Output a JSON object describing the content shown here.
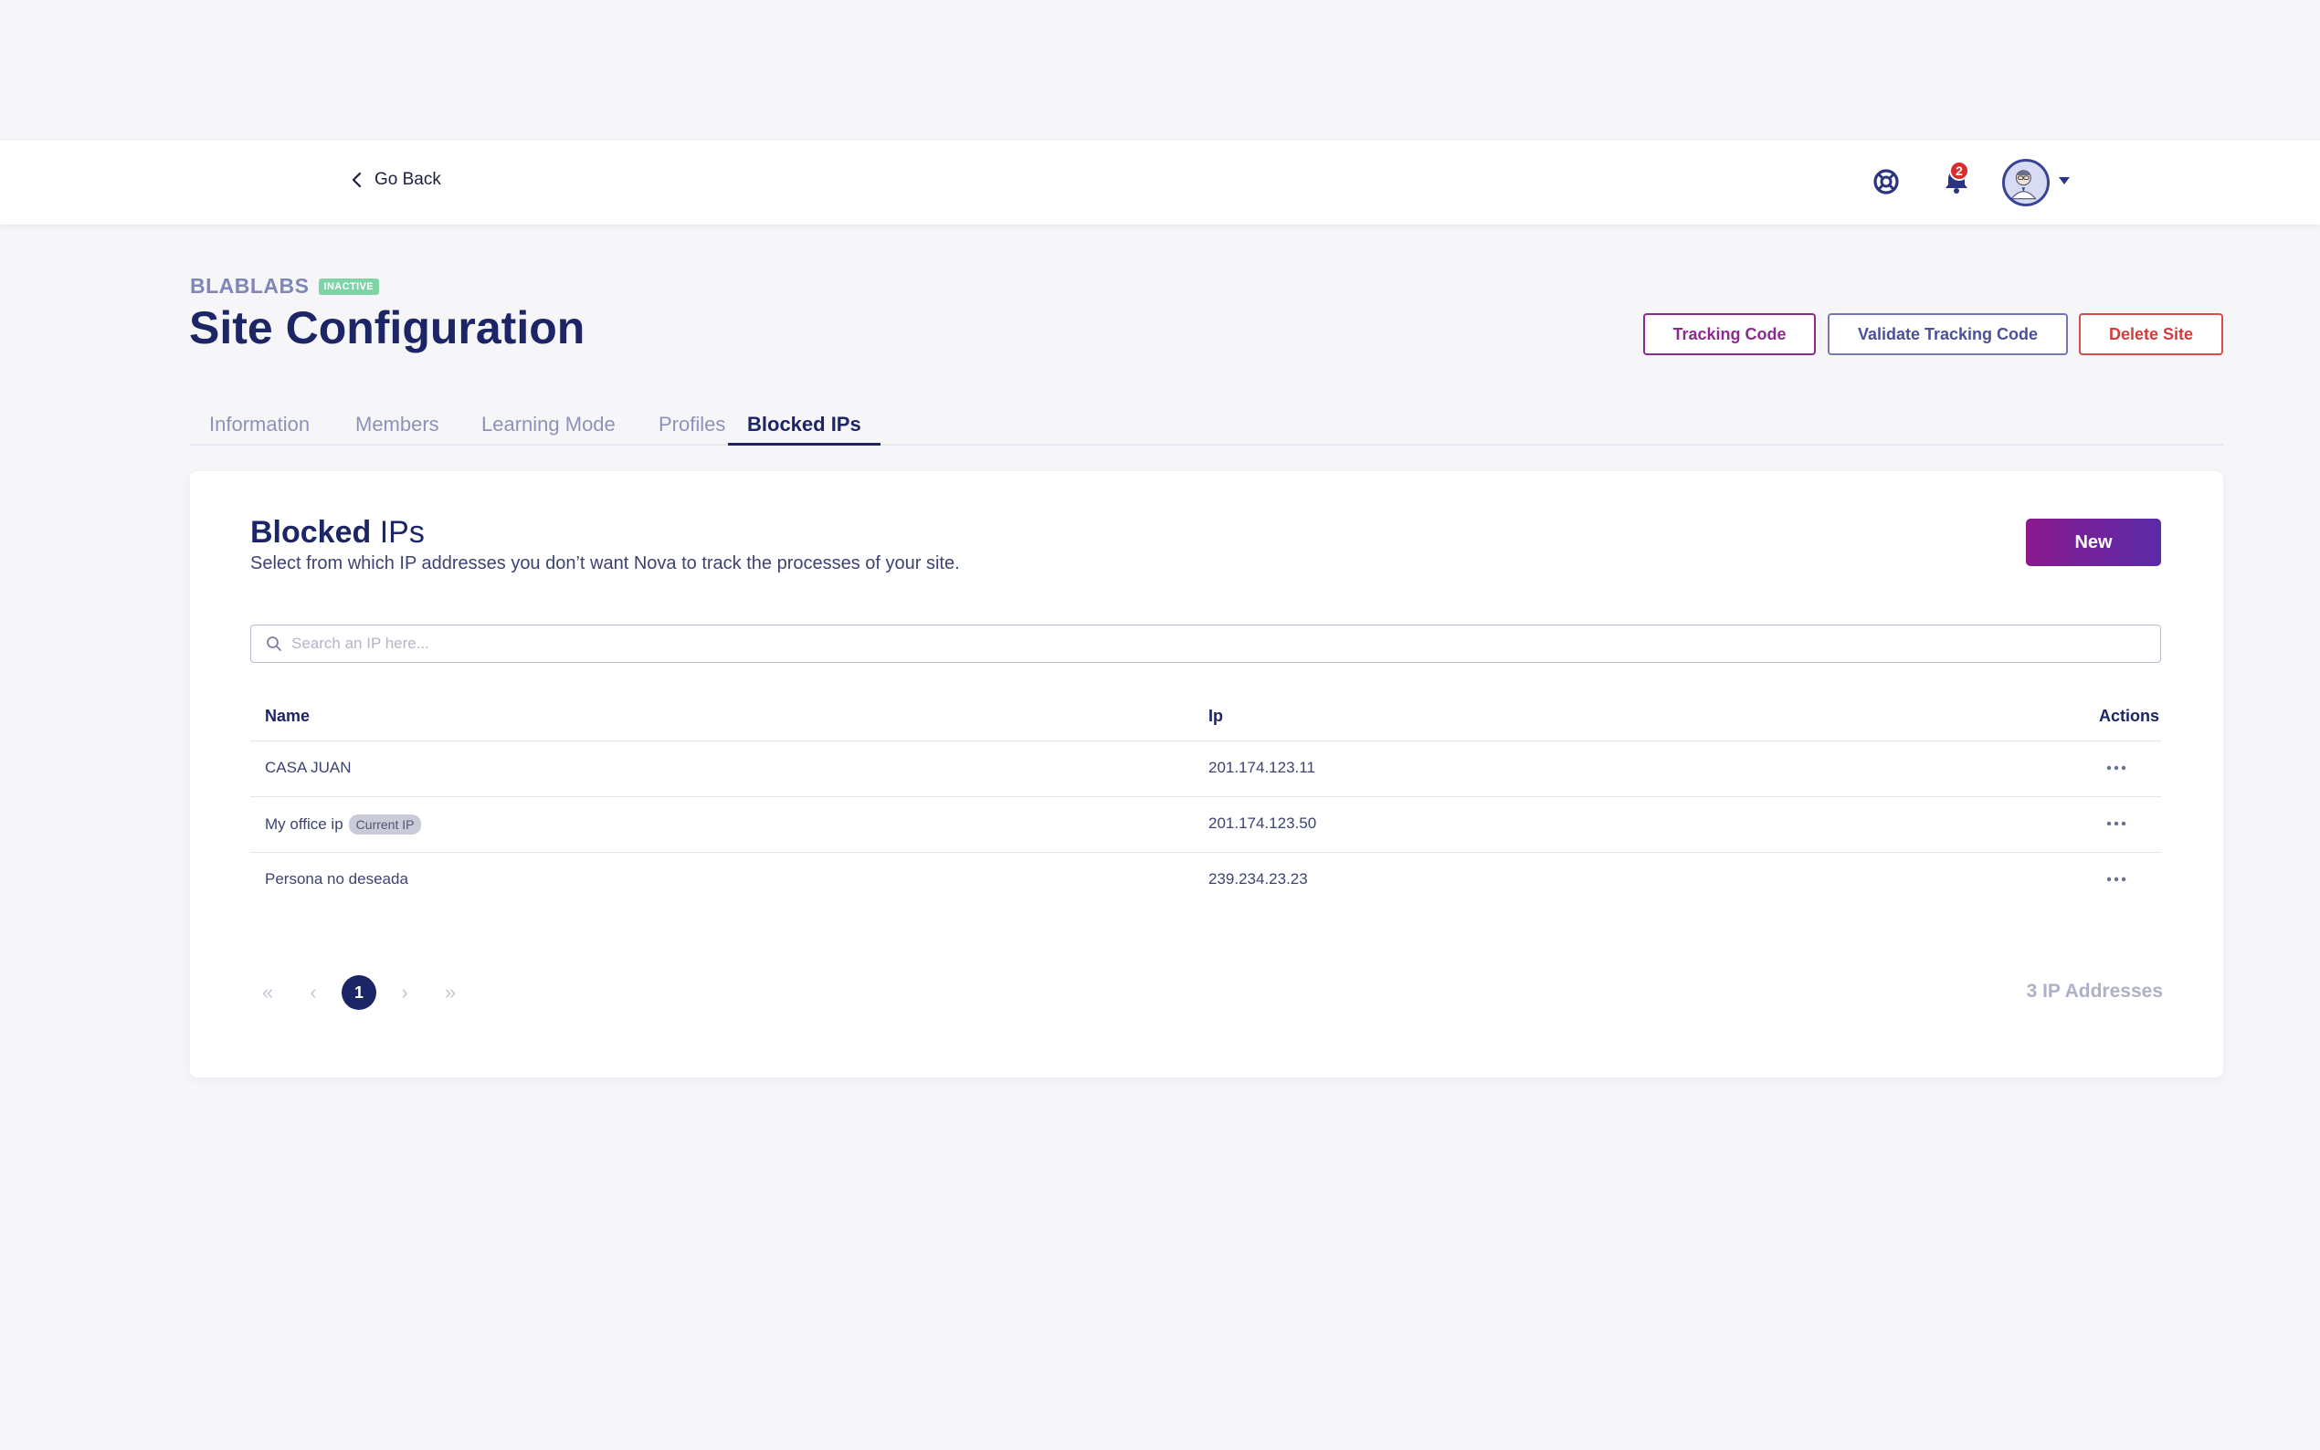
{
  "topbar": {
    "go_back_label": "Go Back",
    "notification_count": "2"
  },
  "site": {
    "name": "BLABLABS",
    "status_badge": "INACTIVE",
    "title": "Site Configuration"
  },
  "header_buttons": {
    "tracking_code": "Tracking Code",
    "validate_tracking_code": "Validate Tracking Code",
    "delete_site": "Delete Site"
  },
  "tabs": [
    {
      "label": "Information",
      "active": false
    },
    {
      "label": "Members",
      "active": false
    },
    {
      "label": "Learning Mode",
      "active": false
    },
    {
      "label": "Profiles",
      "active": false
    },
    {
      "label": "Blocked IPs",
      "active": true
    }
  ],
  "card": {
    "title_bold": "Blocked",
    "title_rest": " IPs",
    "subtitle": "Select from which IP addresses you don’t want Nova to track the processes of your site.",
    "new_button": "New",
    "search_placeholder": "Search an IP here..."
  },
  "table": {
    "headers": {
      "name": "Name",
      "ip": "Ip",
      "actions": "Actions"
    },
    "rows": [
      {
        "name": "CASA JUAN",
        "tag": "",
        "ip": "201.174.123.11"
      },
      {
        "name": "My office ip",
        "tag": "Current IP",
        "ip": "201.174.123.50"
      },
      {
        "name": "Persona no deseada",
        "tag": "",
        "ip": "239.234.23.23"
      }
    ]
  },
  "pagination": {
    "first": "«",
    "prev": "‹",
    "current_page": "1",
    "next": "›",
    "last": "»",
    "total_label": "3 IP Addresses"
  },
  "colors": {
    "primary": "#1c2566",
    "accent_purple": "#8c2a91",
    "danger": "#d23c3c",
    "inactive_badge": "#7fd4a6"
  }
}
